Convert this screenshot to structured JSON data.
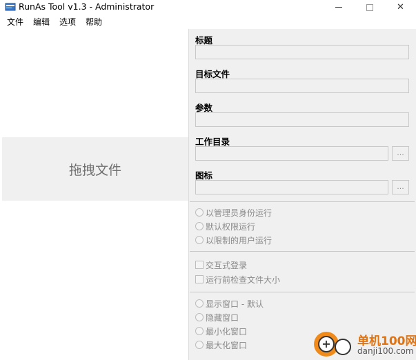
{
  "window": {
    "title": "RunAs Tool v1.3 - Administrator",
    "minimize": "–",
    "close": "✕"
  },
  "menu": [
    "文件",
    "编辑",
    "选项",
    "帮助"
  ],
  "drop_zone": {
    "label": "拖拽文件"
  },
  "fields": {
    "title_label": "标题",
    "target_label": "目标文件",
    "args_label": "参数",
    "workdir_label": "工作目录",
    "icon_label": "图标",
    "browse_label": "..."
  },
  "run_mode": [
    "以管理员身份运行",
    "默认权限运行",
    "以限制的用户运行"
  ],
  "checks": [
    "交互式登录",
    "运行前检查文件大小"
  ],
  "window_mode": [
    "显示窗口 - 默认",
    "隐藏窗口",
    "最小化窗口",
    "最大化窗口"
  ],
  "watermark": {
    "name": "单机100网",
    "url": "danji100.com"
  },
  "colors": {
    "panel_bg": "#f0f0f0",
    "watermark_orange": "#f08a1a"
  }
}
